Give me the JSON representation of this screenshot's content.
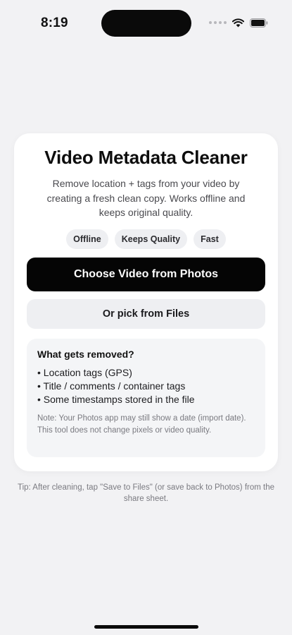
{
  "status_bar": {
    "time": "8:19"
  },
  "icons": {
    "signal": "signal-dots-icon",
    "wifi": "wifi-icon",
    "battery": "battery-icon"
  },
  "card": {
    "title": "Video Metadata Cleaner",
    "subtitle": "Remove location + tags from your video by creating a fresh clean copy. Works offline and keeps original quality.",
    "chips": [
      "Offline",
      "Keeps Quality",
      "Fast"
    ],
    "primary_button": "Choose Video from Photos",
    "secondary_button": "Or pick from Files",
    "info": {
      "title": "What gets removed?",
      "items": [
        "• Location tags (GPS)",
        "• Title / comments / container tags",
        "• Some timestamps stored in the file"
      ],
      "note": "Note: Your Photos app may still show a date (import date). This tool does not change pixels or video quality."
    }
  },
  "tip": "Tip: After cleaning, tap \"Save to Files\" (or save back to Photos) from the share sheet.",
  "colors": {
    "background": "#f2f2f4",
    "card": "#ffffff",
    "primary_button": "#050505",
    "chip": "#eeeff2"
  }
}
